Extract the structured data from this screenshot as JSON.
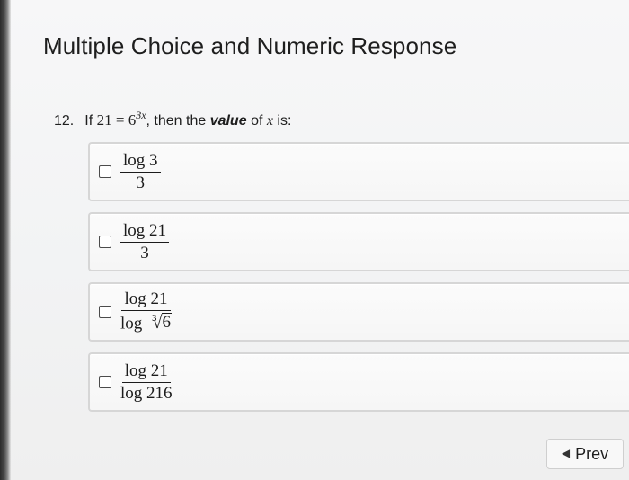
{
  "header": {
    "title": "Multiple Choice and Numeric Response"
  },
  "question": {
    "number": "12.",
    "prefix": "If",
    "lhs": "21",
    "equals": "=",
    "base": "6",
    "exponent": "3x",
    "text_mid": ", then the",
    "bold_word": "value",
    "text_of": "of",
    "variable": "x",
    "text_end": "is:"
  },
  "choices": [
    {
      "numerator": "log 3",
      "denominator": "3"
    },
    {
      "numerator": "log 21",
      "denominator": "3"
    },
    {
      "numerator": "log 21",
      "denominator_prefix": "log",
      "radical_index": "3",
      "radicand": "6"
    },
    {
      "numerator": "log 21",
      "denominator": "log 216"
    }
  ],
  "nav": {
    "prev_label": "Prev",
    "prev_icon": "triangle-left-icon"
  }
}
